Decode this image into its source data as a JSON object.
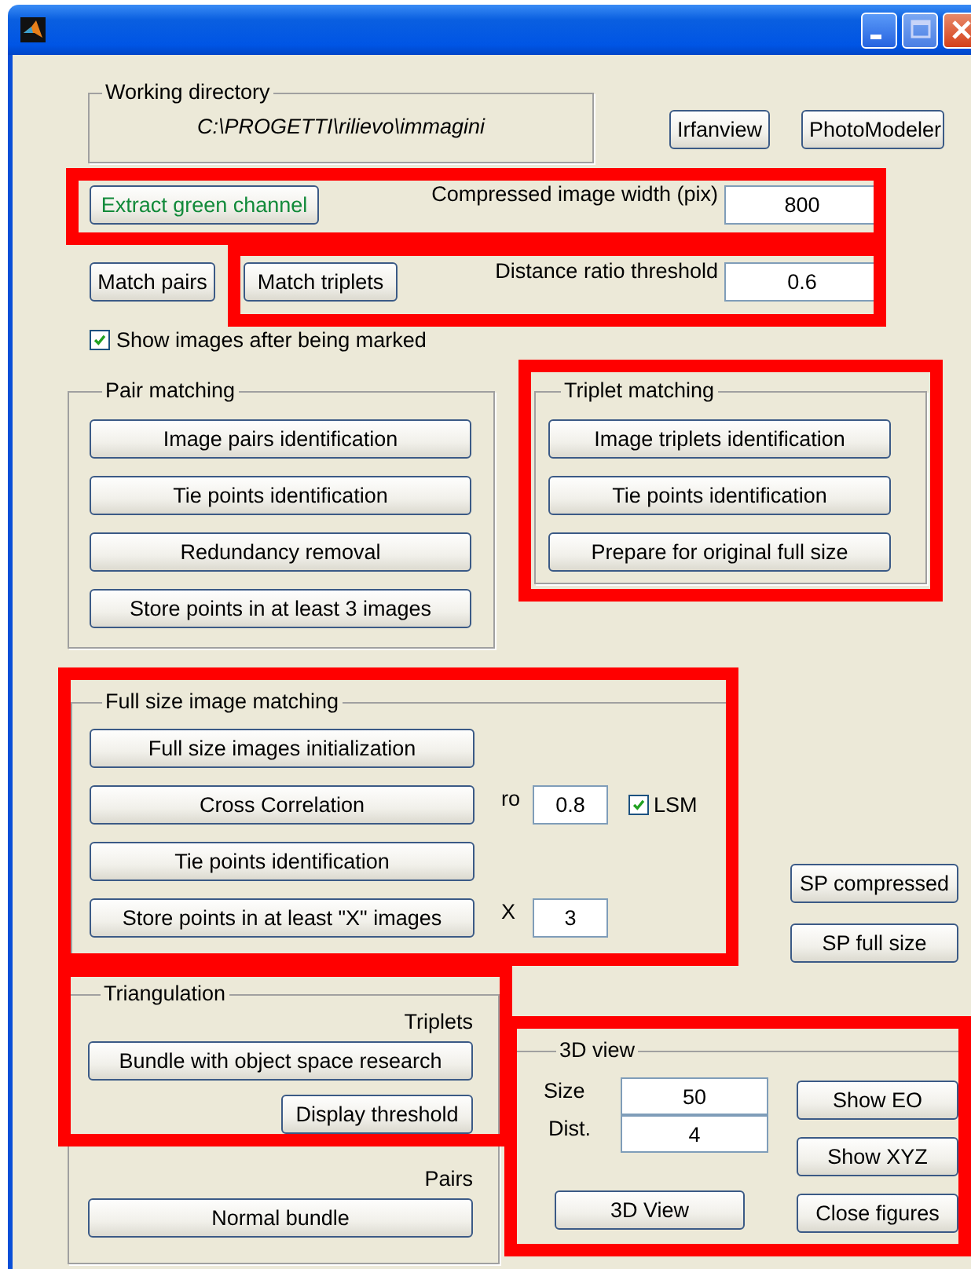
{
  "working_directory": {
    "label": "Working directory",
    "path": "C:\\PROGETTI\\rilievo\\immagini"
  },
  "tool_buttons": [
    "Irfanview",
    "PhotoModeler"
  ],
  "extract_button": "Extract green channel",
  "compressed_width": {
    "label": "Compressed image width (pix)",
    "value": "800"
  },
  "match_buttons": [
    "Match pairs",
    "Match triplets"
  ],
  "distance_ratio": {
    "label": "Distance ratio threshold",
    "value": "0.6"
  },
  "show_images": {
    "label": "Show images after being marked",
    "checked": true
  },
  "pair_matching": {
    "title": "Pair matching",
    "buttons": [
      "Image pairs identification",
      "Tie points identification",
      "Redundancy removal",
      "Store points in at least 3 images"
    ]
  },
  "triplet_matching": {
    "title": "Triplet matching",
    "buttons": [
      "Image triplets identification",
      "Tie points identification",
      "Prepare for original full size"
    ]
  },
  "full_size": {
    "title": "Full size image matching",
    "rows": [
      {
        "button": "Full size images initialization"
      },
      {
        "button": "Cross Correlation",
        "field_label": "ro",
        "value": "0.8",
        "checkbox": {
          "label": "LSM",
          "checked": true
        }
      },
      {
        "button": "Tie points identification"
      },
      {
        "button": "Store points in at least \"X\" images",
        "field_label": "X",
        "value": "3"
      }
    ]
  },
  "sp_buttons": [
    "SP compressed",
    "SP full size"
  ],
  "triangulation": {
    "title": "Triangulation",
    "triplets_label": "Triplets",
    "bundle_button": "Bundle with object space research",
    "threshold_button": "Display threshold",
    "pairs_label": "Pairs",
    "normal_button": "Normal bundle"
  },
  "view_3d": {
    "title": "3D view",
    "fields": [
      {
        "label": "Size",
        "value": "50"
      },
      {
        "label": "Dist.",
        "value": "4"
      }
    ],
    "view_button": "3D View",
    "side_buttons": [
      "Show EO",
      "Show XYZ",
      "Close figures"
    ]
  }
}
